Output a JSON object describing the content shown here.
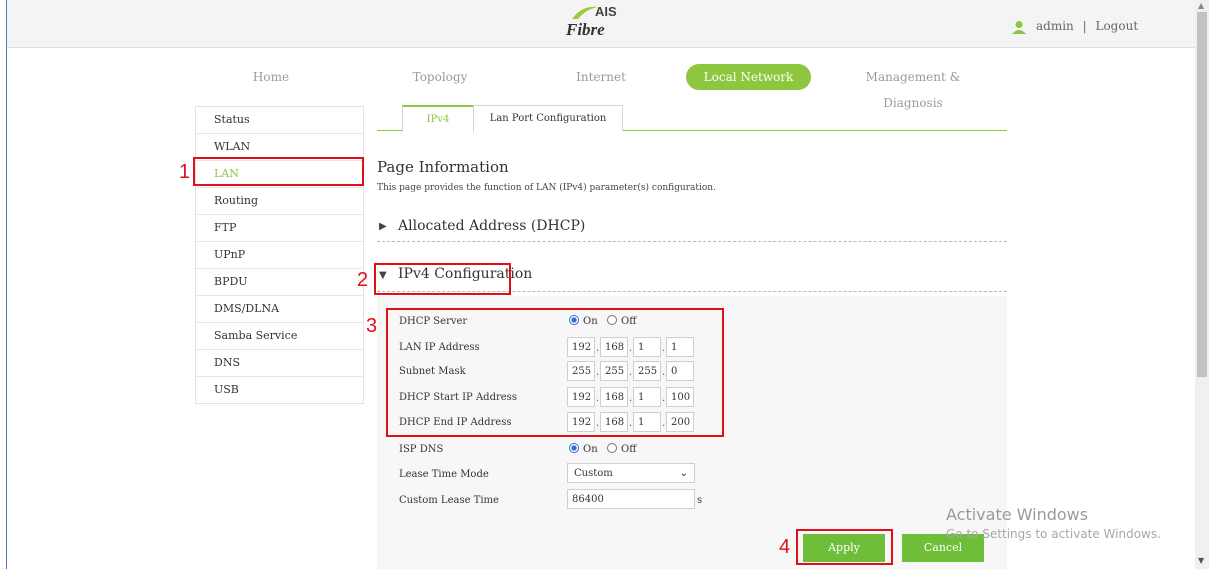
{
  "header": {
    "brand_top": "AIS",
    "brand_bottom": "Fibre",
    "user": "admin",
    "separator": "|",
    "logout": "Logout"
  },
  "nav": {
    "items": [
      "Home",
      "Topology",
      "Internet",
      "Local Network",
      "Management & Diagnosis"
    ],
    "active": "Local Network"
  },
  "sidebar": {
    "items": [
      "Status",
      "WLAN",
      "LAN",
      "Routing",
      "FTP",
      "UPnP",
      "BPDU",
      "DMS/DLNA",
      "Samba Service",
      "DNS",
      "USB"
    ],
    "active": "LAN"
  },
  "tabs": [
    "IPv4",
    "Lan Port Configuration"
  ],
  "page": {
    "title": "Page Information",
    "description": "This page provides the function of LAN (IPv4) parameter(s) configuration."
  },
  "sections": {
    "allocated": "Allocated Address (DHCP)",
    "ipv4": "IPv4 Configuration"
  },
  "form": {
    "dhcp_server": {
      "label": "DHCP Server",
      "value": "On",
      "on": "On",
      "off": "Off"
    },
    "lan_ip": {
      "label": "LAN IP Address",
      "octets": [
        "192",
        "168",
        "1",
        "1"
      ]
    },
    "subnet": {
      "label": "Subnet Mask",
      "octets": [
        "255",
        "255",
        "255",
        "0"
      ]
    },
    "dhcp_start": {
      "label": "DHCP Start IP Address",
      "octets": [
        "192",
        "168",
        "1",
        "100"
      ]
    },
    "dhcp_end": {
      "label": "DHCP End IP Address",
      "octets": [
        "192",
        "168",
        "1",
        "200"
      ]
    },
    "isp_dns": {
      "label": "ISP DNS",
      "value": "On",
      "on": "On",
      "off": "Off"
    },
    "lease_mode": {
      "label": "Lease Time Mode",
      "value": "Custom"
    },
    "lease_time": {
      "label": "Custom Lease Time",
      "value": "86400",
      "unit": "s"
    }
  },
  "buttons": {
    "apply": "Apply",
    "cancel": "Cancel"
  },
  "annotations": [
    "1",
    "2",
    "3",
    "4"
  ],
  "watermark": {
    "line1": "Activate Windows",
    "line2": "Go to Settings to activate Windows."
  },
  "colors": {
    "accent": "#8dc63f",
    "highlight": "#e0101a",
    "radio": "#2f6fd6"
  }
}
